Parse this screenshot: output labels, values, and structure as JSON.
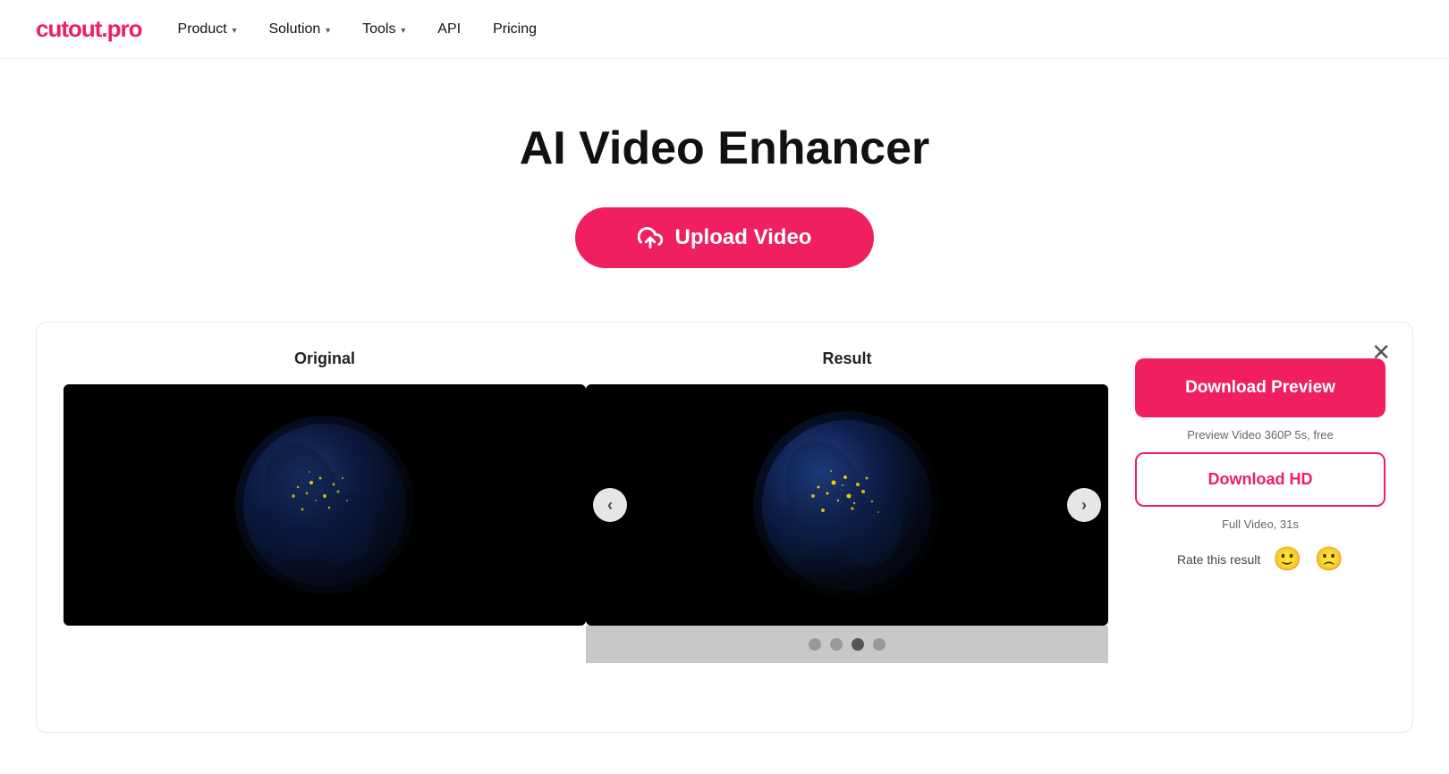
{
  "nav": {
    "logo": "cutout.pro",
    "logo_dot": ".",
    "items": [
      {
        "label": "Product",
        "has_dropdown": true
      },
      {
        "label": "Solution",
        "has_dropdown": true
      },
      {
        "label": "Tools",
        "has_dropdown": true
      },
      {
        "label": "API",
        "has_dropdown": false
      },
      {
        "label": "Pricing",
        "has_dropdown": false
      }
    ]
  },
  "hero": {
    "title": "AI Video Enhancer",
    "upload_label": "Upload Video"
  },
  "comparison": {
    "original_label": "Original",
    "result_label": "Result",
    "download_preview_label": "Download Preview",
    "preview_note": "Preview Video 360P 5s, free",
    "download_hd_label": "Download HD",
    "full_video_note": "Full Video, 31s",
    "rate_label": "Rate this result",
    "dots": [
      1,
      2,
      3,
      4
    ],
    "active_dot": 3
  }
}
